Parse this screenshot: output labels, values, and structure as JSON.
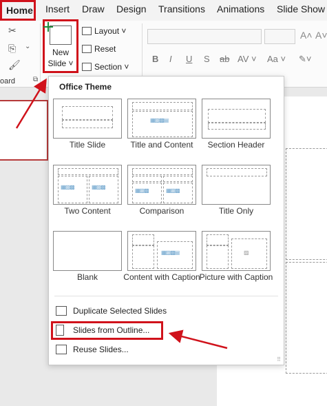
{
  "ribbon_tabs": [
    "Home",
    "Insert",
    "Draw",
    "Design",
    "Transitions",
    "Animations",
    "Slide Show"
  ],
  "clipboard_group_label": "oard",
  "new_slide": {
    "line1": "New",
    "line2": "Slide ˅"
  },
  "slides_commands": {
    "layout": "Layout ˅",
    "reset": "Reset",
    "section": "Section ˅"
  },
  "font_format_buttons": [
    "B",
    "I",
    "U",
    "S",
    "ab",
    "AV ˅",
    "Aa ˅"
  ],
  "dropdown": {
    "theme_title": "Office Theme",
    "layouts": [
      "Title Slide",
      "Title and Content",
      "Section Header",
      "Two Content",
      "Comparison",
      "Title Only",
      "Blank",
      "Content with Caption",
      "Picture with Caption"
    ],
    "menu_items": [
      "Duplicate Selected Slides",
      "Slides from Outline...",
      "Reuse Slides..."
    ]
  },
  "annotation_color": "#d0121b"
}
